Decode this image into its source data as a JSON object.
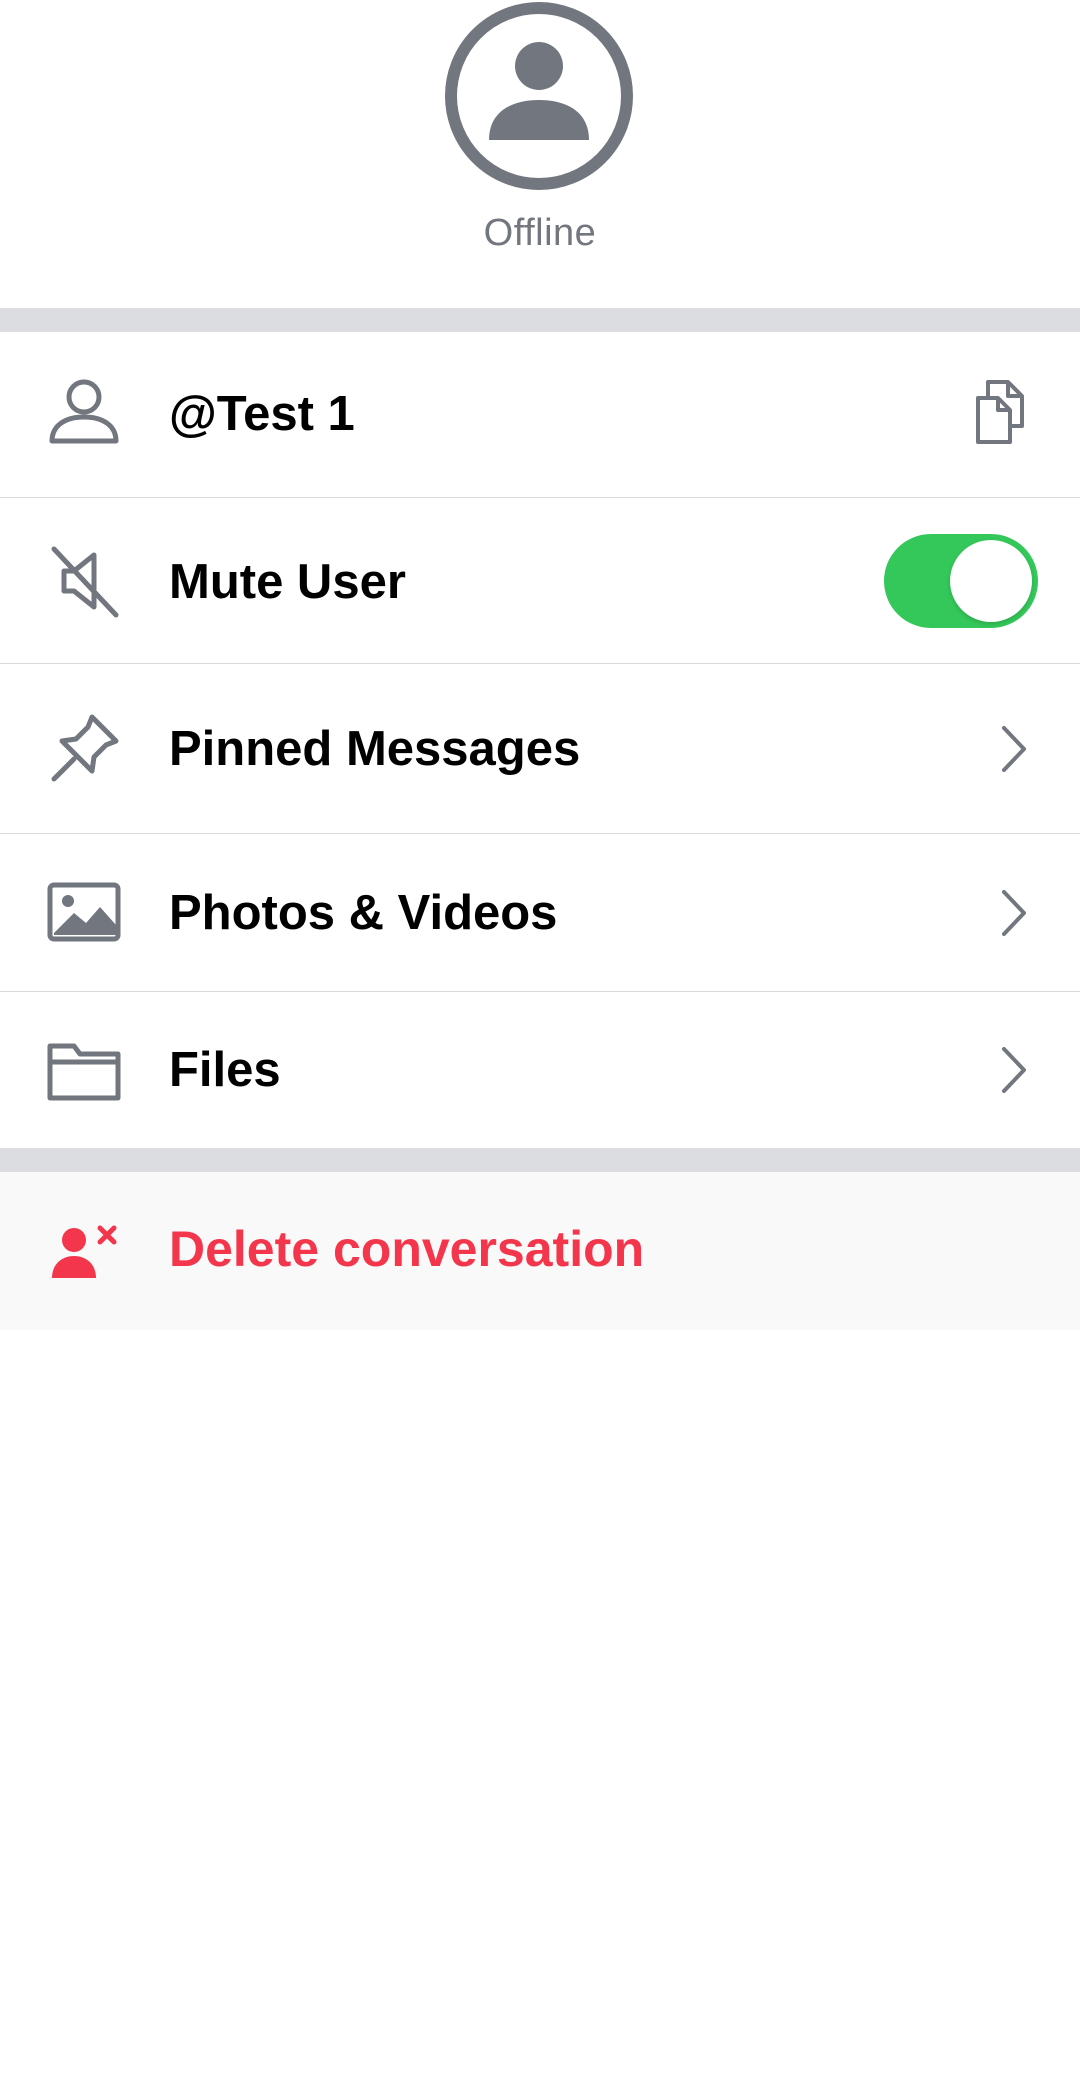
{
  "profile": {
    "status": "Offline",
    "avatar_icon": "user-avatar-icon"
  },
  "rows": [
    {
      "label": "@Test 1",
      "icon": "person-icon",
      "trailing": "copy-icon"
    },
    {
      "label": "Mute User",
      "icon": "mute-speaker-icon",
      "trailing": "toggle",
      "toggle_on": true
    },
    {
      "label": "Pinned Messages",
      "icon": "pin-icon",
      "trailing": "chevron-right-icon"
    },
    {
      "label": "Photos & Videos",
      "icon": "image-icon",
      "trailing": "chevron-right-icon"
    },
    {
      "label": "Files",
      "icon": "folder-icon",
      "trailing": "chevron-right-icon"
    }
  ],
  "danger": {
    "label": "Delete conversation",
    "icon": "remove-user-icon"
  },
  "colors": {
    "icon_gray": "#72767e",
    "toggle_on": "#34c759",
    "danger": "#f4364c",
    "divider": "#dcdde1"
  }
}
